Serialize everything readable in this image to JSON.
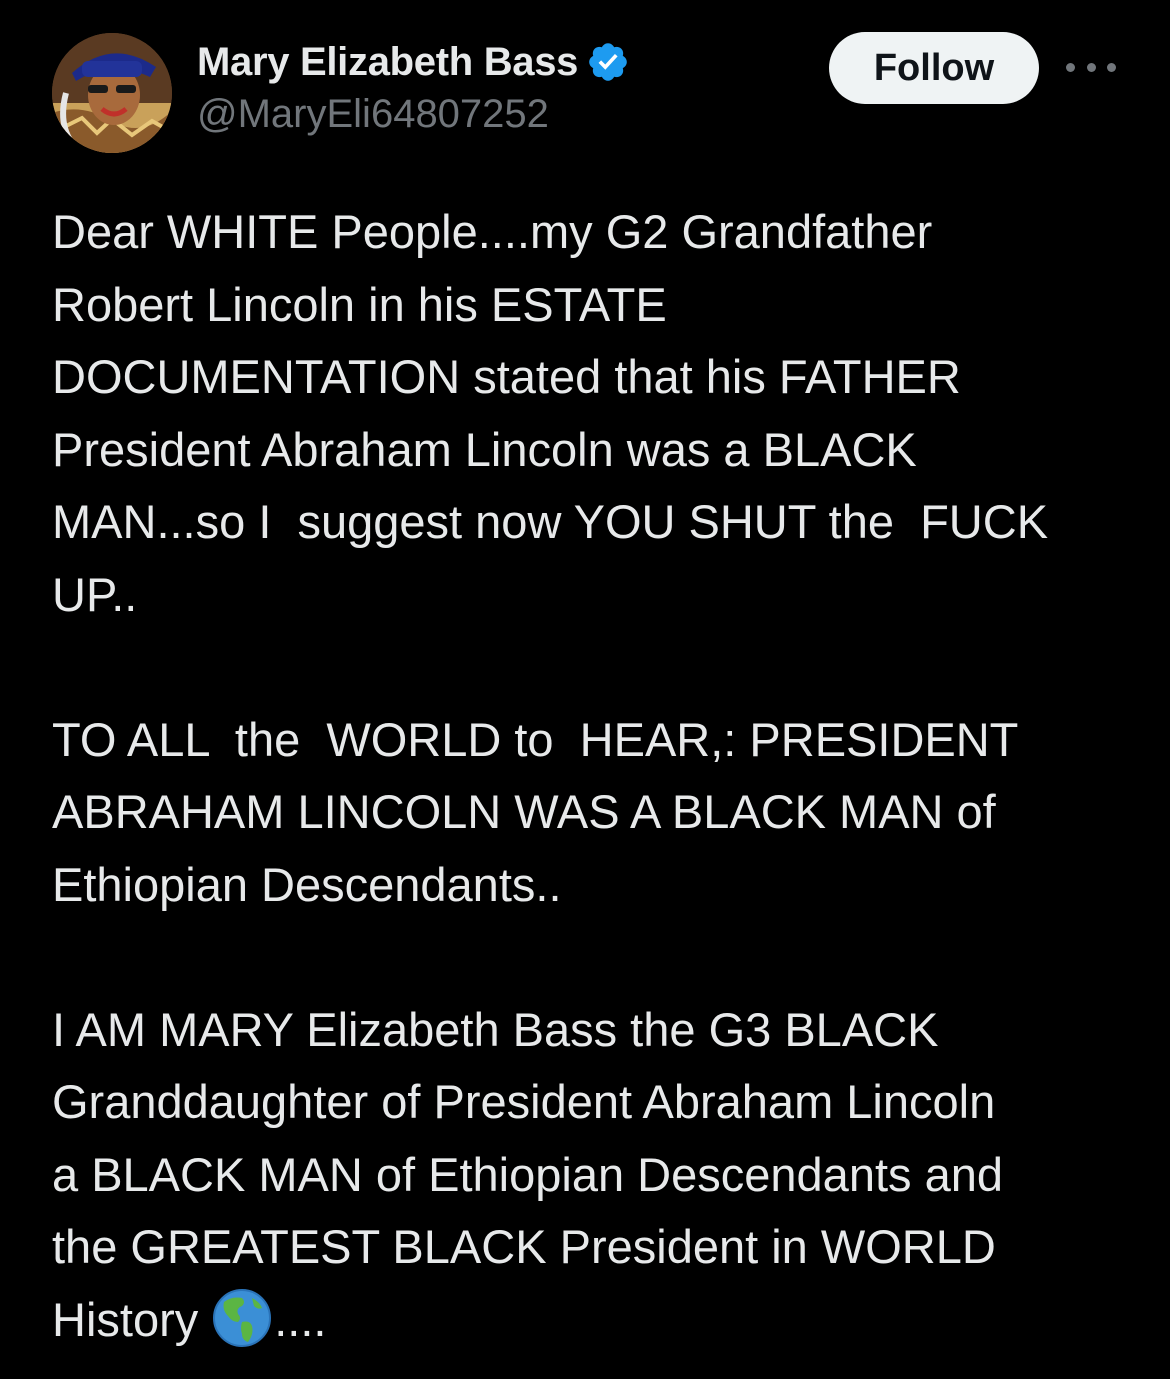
{
  "author": {
    "display_name": "Mary Elizabeth Bass",
    "handle": "@MaryEli64807252",
    "verified_icon": "verified-badge-icon",
    "avatar_icon": "profile-avatar"
  },
  "actions": {
    "follow_label": "Follow",
    "more_icon": "more-options-icon"
  },
  "tweet": {
    "paragraphs": [
      "Dear WHITE People....my G2 Grandfather\nRobert Lincoln in his ESTATE\nDOCUMENTATION stated that his FATHER\nPresident Abraham Lincoln was a BLACK\nMAN...so I  suggest now YOU SHUT the  FUCK\nUP..",
      "TO ALL  the  WORLD to  HEAR,: PRESIDENT\nABRAHAM LINCOLN WAS A BLACK MAN of\nEthiopian Descendants..",
      "I AM MARY Elizabeth Bass the G3 BLACK\nGranddaughter of President Abraham Lincoln\na BLACK MAN of Ethiopian Descendants and\nthe GREATEST BLACK President in WORLD\nHistory"
    ],
    "trailing_emoji": "globe-americas-icon",
    "trailing_text": "...."
  },
  "colors": {
    "background": "#000000",
    "text_primary": "#e7e9ea",
    "text_secondary": "#71767b",
    "verified_blue": "#1d9bf0",
    "follow_bg": "#eff3f4"
  }
}
